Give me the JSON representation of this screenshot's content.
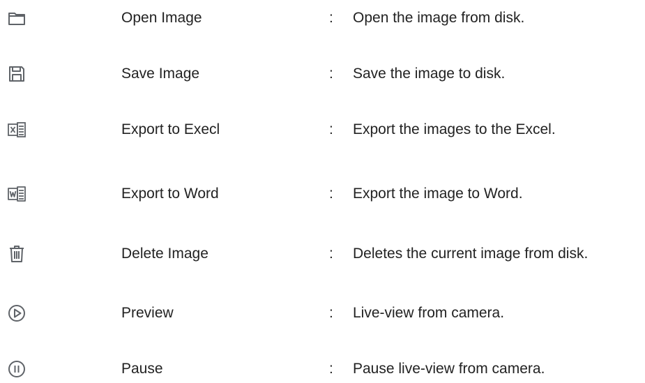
{
  "colors": {
    "text": "#222222",
    "icon": "#5f6368"
  },
  "rows": [
    {
      "icon": "folder-open-icon",
      "name": "Open Image",
      "colon": ":",
      "description": "Open the image from disk."
    },
    {
      "icon": "floppy-disk-icon",
      "name": "Save Image",
      "colon": ":",
      "description": "Save the image to disk."
    },
    {
      "icon": "excel-icon",
      "name": "Export to Execl",
      "colon": ":",
      "description": "Export the images to the Excel."
    },
    {
      "icon": "word-icon",
      "name": "Export to Word",
      "colon": ":",
      "description": "Export the image to Word."
    },
    {
      "icon": "trash-icon",
      "name": "Delete Image",
      "colon": ":",
      "description": "Deletes the current image from disk."
    },
    {
      "icon": "play-circle-icon",
      "name": "Preview",
      "colon": ":",
      "description": "Live-view from camera."
    },
    {
      "icon": "pause-circle-icon",
      "name": "Pause",
      "colon": ":",
      "description": "Pause live-view from camera."
    }
  ]
}
